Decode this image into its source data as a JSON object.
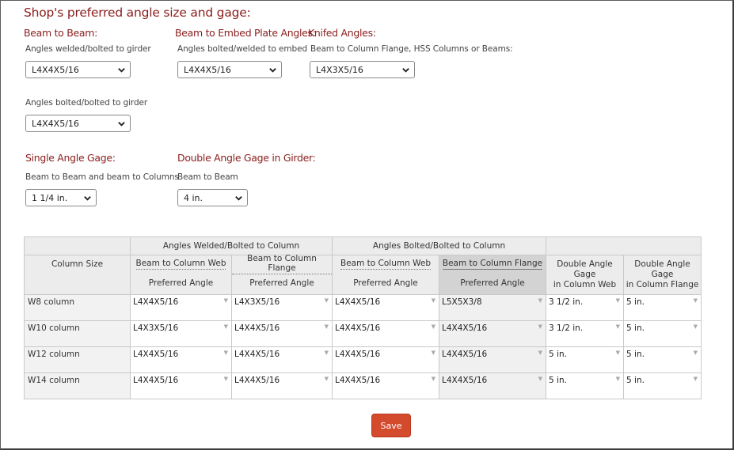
{
  "title": "Shop's preferred angle size and gage:",
  "beam_to_beam": {
    "heading": "Beam to Beam:",
    "welded_label": "Angles welded/bolted to girder",
    "welded_value": "L4X4X5/16",
    "bolted_label": "Angles bolted/bolted to girder",
    "bolted_value": "L4X4X5/16"
  },
  "embed_plate": {
    "heading": "Beam to Embed Plate Angles:",
    "label": "Angles bolted/welded to embed",
    "value": "L4X4X5/16"
  },
  "knifed": {
    "heading": "Knifed Angles:",
    "label": "Beam to Column Flange, HSS Columns or Beams:",
    "value": "L4X3X5/16"
  },
  "single_gage": {
    "heading": "Single Angle Gage:",
    "label": "Beam to Beam and beam to Columns",
    "value": "1 1/4 in."
  },
  "double_gage": {
    "heading": "Double Angle Gage in Girder:",
    "label": "Beam to Beam",
    "value": "4 in."
  },
  "table": {
    "col_size": "Column Size",
    "group_welded": "Angles Welded/Bolted to Column",
    "group_bolted": "Angles Bolted/Bolted to Column",
    "web_label": "Beam to Column Web",
    "flange_label": "Beam to Column Flange",
    "preferred_angle": "Preferred Angle",
    "dbl_web_1": "Double Angle Gage",
    "dbl_web_2": "in Column Web",
    "dbl_flange_1": "Double Angle Gage",
    "dbl_flange_2": "in Column Flange",
    "rows": [
      {
        "size": "W8 column",
        "c1": "L4X4X5/16",
        "c2": "L4X3X5/16",
        "c3": "L4X4X5/16",
        "c4": "L5X5X3/8",
        "c5": "3 1/2 in.",
        "c6": "5 in."
      },
      {
        "size": "W10  column",
        "c1": "L4X3X5/16",
        "c2": "L4X4X5/16",
        "c3": "L4X4X5/16",
        "c4": "L4X4X5/16",
        "c5": "3 1/2 in.",
        "c6": "5 in."
      },
      {
        "size": "W12 column",
        "c1": "L4X4X5/16",
        "c2": "L4X4X5/16",
        "c3": "L4X4X5/16",
        "c4": "L4X4X5/16",
        "c5": "5 in.",
        "c6": "5 in."
      },
      {
        "size": "W14  column",
        "c1": "L4X4X5/16",
        "c2": "L4X4X5/16",
        "c3": "L4X4X5/16",
        "c4": "L4X4X5/16",
        "c5": "5 in.",
        "c6": "5 in."
      }
    ]
  },
  "save_label": "Save",
  "colors": {
    "heading": "#8b1d1d",
    "save_button": "#d44a2c"
  },
  "icons": {
    "dropdown": "chevron-down-icon",
    "cell_dropdown": "triangle-down-icon"
  }
}
